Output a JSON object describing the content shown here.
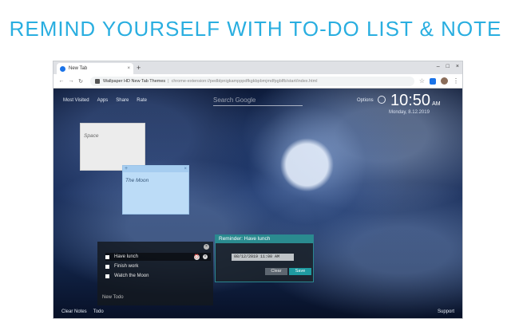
{
  "banner": {
    "title": "REMIND YOURSELF WITH TO-DO LIST & NOTE"
  },
  "browser": {
    "tab": {
      "title": "New Tab",
      "close": "×"
    },
    "new_tab": "+",
    "window_controls": [
      "–",
      "□",
      "×"
    ],
    "toolbar": {
      "back": "←",
      "forward": "→",
      "reload": "↻",
      "omnibox": {
        "site": "Wallpaper HD New Tab Themes",
        "url": "chrome-extension://pedblpnigkampppdfkgkbpbmjmdfpgblfb/start/index.html"
      },
      "star": "☆",
      "menu": "⋮"
    }
  },
  "page": {
    "top_links": [
      "Most Visited",
      "Apps",
      "Share",
      "Rate"
    ],
    "search_placeholder": "Search Google",
    "options": "Options",
    "clock": "10:50",
    "clock_suffix": "AM",
    "date": "Monday, 8.12.2019"
  },
  "notes": {
    "space": {
      "text": "Space"
    },
    "moon": {
      "text": "The Moon",
      "add": "+",
      "close": "×"
    }
  },
  "todo": {
    "close": "×",
    "items": [
      {
        "label": "Have lunch",
        "active": true,
        "alarm": "⏰",
        "delete": "×"
      },
      {
        "label": "Finish work"
      },
      {
        "label": "Watch the Moon"
      }
    ],
    "new_placeholder": "New Todo"
  },
  "reminder": {
    "title": "Reminder: Have lunch",
    "datetime": "08/12/2019 11:00 AM",
    "clear": "Clear",
    "save": "Save"
  },
  "footer": {
    "left": [
      "Clear Notes",
      "Todo"
    ],
    "right": "Support"
  },
  "colors": {
    "banner": "#29aee0",
    "reminder_accent": "#2a8b8f",
    "save_button": "#1f9aa0"
  }
}
